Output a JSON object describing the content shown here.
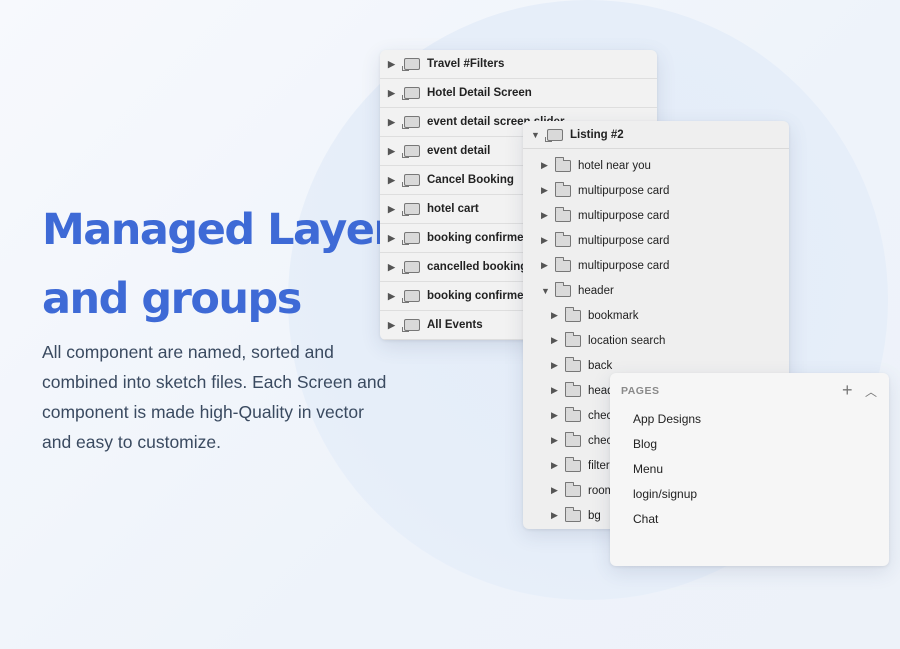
{
  "hero": {
    "title_line1": "Managed Layer",
    "title_line2": "and groups",
    "description_line1": "All component are named, sorted and",
    "description_line2": "combined into sketch files. Each Screen and",
    "description_line3": "component is made high-Quality in vector",
    "description_line4": "and easy to customize."
  },
  "artboards_panel": {
    "items": [
      {
        "label": "Travel #Filters"
      },
      {
        "label": "Hotel Detail Screen"
      },
      {
        "label": "event detail screen slider"
      },
      {
        "label": "event detail"
      },
      {
        "label": "Cancel Booking"
      },
      {
        "label": "hotel cart"
      },
      {
        "label": "booking confirmed"
      },
      {
        "label": "cancelled booking"
      },
      {
        "label": "booking confirmed"
      },
      {
        "label": "All Events"
      }
    ]
  },
  "layers_panel": {
    "title": "Listing #2",
    "items": [
      {
        "label": "hotel near you",
        "level": 1,
        "expanded": false
      },
      {
        "label": "multipurpose card",
        "level": 1,
        "expanded": false
      },
      {
        "label": "multipurpose card",
        "level": 1,
        "expanded": false
      },
      {
        "label": "multipurpose card",
        "level": 1,
        "expanded": false
      },
      {
        "label": "multipurpose card",
        "level": 1,
        "expanded": false
      },
      {
        "label": "header",
        "level": 1,
        "expanded": true
      },
      {
        "label": "bookmark",
        "level": 2,
        "expanded": false
      },
      {
        "label": "location search",
        "level": 2,
        "expanded": false
      },
      {
        "label": "back",
        "level": 2,
        "expanded": false
      },
      {
        "label": "header",
        "level": 2,
        "expanded": false
      },
      {
        "label": "check",
        "level": 2,
        "expanded": false
      },
      {
        "label": "check",
        "level": 2,
        "expanded": false
      },
      {
        "label": "filter",
        "level": 2,
        "expanded": false
      },
      {
        "label": "room",
        "level": 2,
        "expanded": false
      },
      {
        "label": "bg",
        "level": 2,
        "expanded": false
      }
    ]
  },
  "pages_panel": {
    "title": "PAGES",
    "add_icon": "plus-icon",
    "collapse_icon": "chevron-up-icon",
    "pages": [
      {
        "label": "App Designs"
      },
      {
        "label": "Blog"
      },
      {
        "label": "Menu"
      },
      {
        "label": "login/signup"
      },
      {
        "label": "Chat"
      }
    ]
  },
  "colors": {
    "accent": "#3e6ad6",
    "text": "#3a4a60"
  }
}
